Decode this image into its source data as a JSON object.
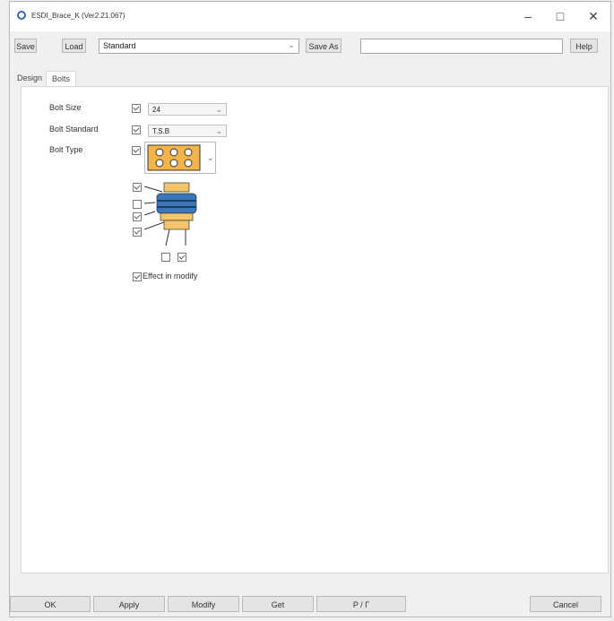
{
  "window": {
    "title": "ESDI_Brace_K (Ver2.21.067)"
  },
  "window_controls": {
    "minimize": "–",
    "maximize": "□",
    "close": "✕"
  },
  "toolbar": {
    "save_label": "Save",
    "load_label": "Load",
    "preset_value": "Standard",
    "save_as_label": "Save As",
    "save_as_value": "",
    "help_label": "Help"
  },
  "tabs": [
    {
      "label": "Design",
      "active": false
    },
    {
      "label": "Bolts",
      "active": true
    }
  ],
  "bolts": {
    "bolt_size": {
      "label": "Bolt Size",
      "checked": true,
      "value": "24"
    },
    "bolt_standard": {
      "label": "Bolt Standard",
      "checked": true,
      "value": "T.S.B"
    },
    "bolt_type": {
      "label": "Bolt Type",
      "checked": true
    },
    "part_checks": [
      true,
      false,
      true,
      true
    ],
    "bottom_checks": [
      false,
      true
    ],
    "effect_in_modify": {
      "label": "Effect in modify",
      "checked": true
    }
  },
  "bottom_bar": {
    "ok": "OK",
    "apply": "Apply",
    "modify": "Modify",
    "get": "Get",
    "toggle": "P / Γ",
    "cancel": "Cancel"
  }
}
